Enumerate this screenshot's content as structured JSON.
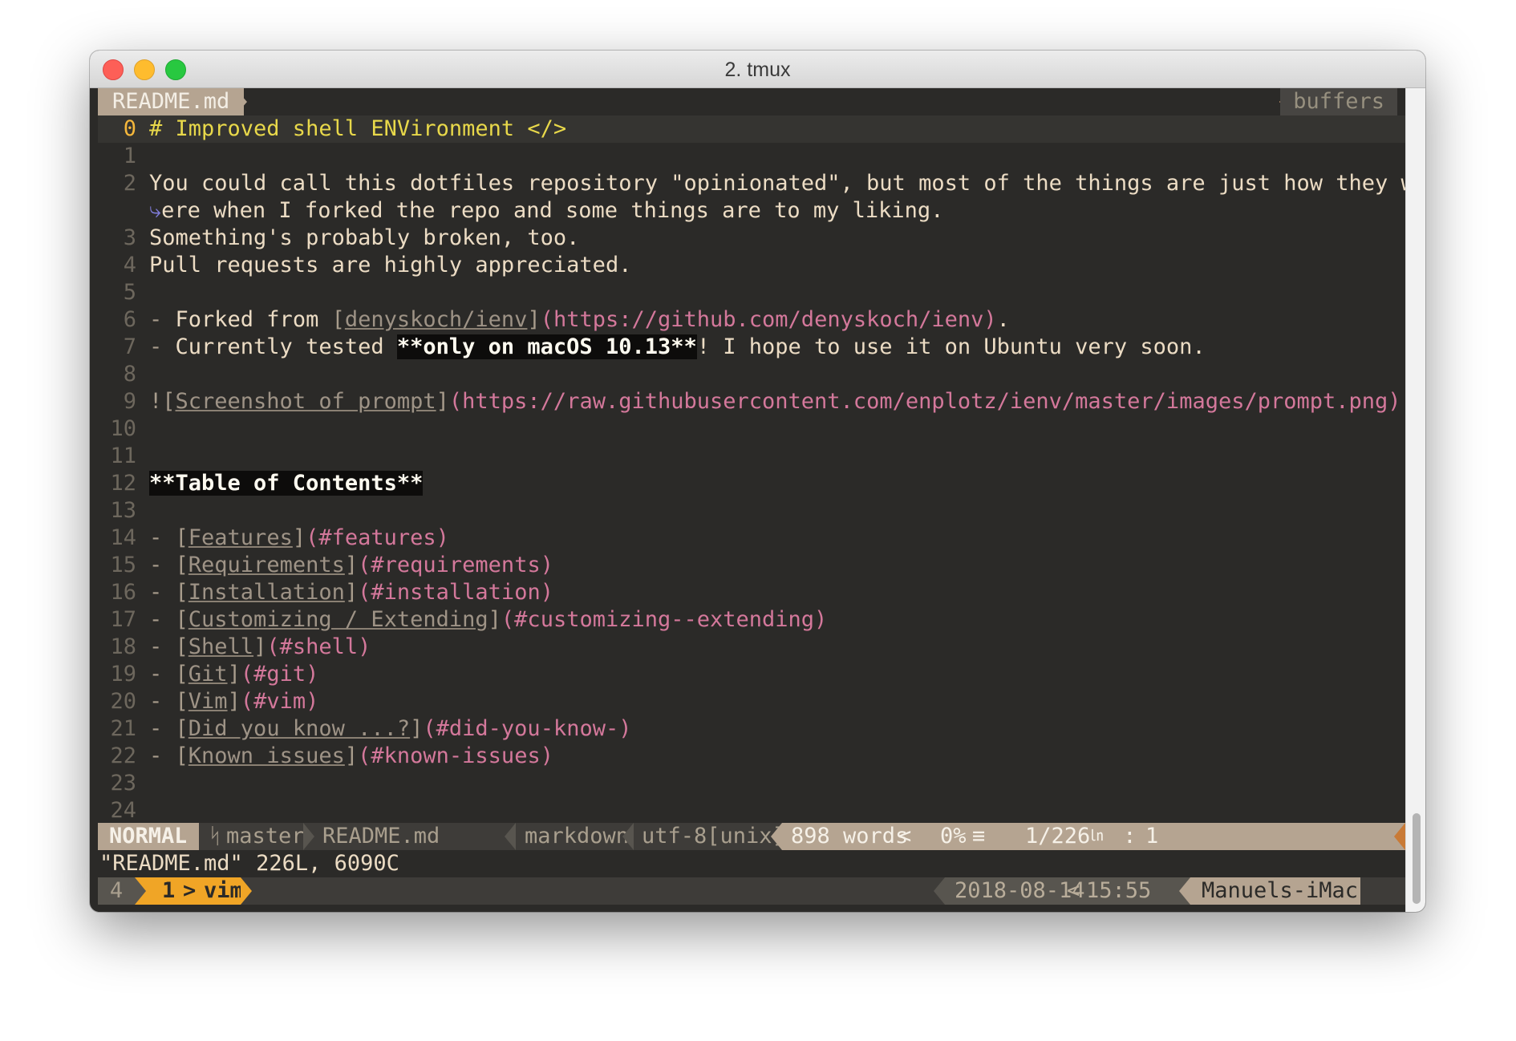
{
  "window": {
    "title": "2. tmux"
  },
  "tabline": {
    "tab_label": "README.md",
    "buffers_label": "buffers"
  },
  "editor": {
    "lines": [
      {
        "n": "0",
        "parts": [
          {
            "t": "# Improved shell ENVironment </>",
            "c": "h1"
          }
        ]
      },
      {
        "n": "1",
        "parts": []
      },
      {
        "n": "2",
        "parts": [
          {
            "t": "You could call this dotfiles repository \"opinionated\", but most of the things are just how they w",
            "c": ""
          }
        ]
      },
      {
        "n": "",
        "parts": [
          {
            "t": "⤷",
            "c": "wrapmark"
          },
          {
            "t": "ere when I forked the repo and some things are to my liking.",
            "c": ""
          }
        ]
      },
      {
        "n": "3",
        "parts": [
          {
            "t": "Something's probably broken, too.",
            "c": ""
          }
        ]
      },
      {
        "n": "4",
        "parts": [
          {
            "t": "Pull requests are highly appreciated.",
            "c": ""
          }
        ]
      },
      {
        "n": "5",
        "parts": []
      },
      {
        "n": "6",
        "parts": [
          {
            "t": "- ",
            "c": "dim"
          },
          {
            "t": "Forked from ",
            "c": ""
          },
          {
            "t": "[",
            "c": "dim"
          },
          {
            "t": "denyskoch/ienv",
            "c": "link"
          },
          {
            "t": "]",
            "c": "dim"
          },
          {
            "t": "(https://github.com/denyskoch/ienv)",
            "c": "url"
          },
          {
            "t": ".",
            "c": ""
          }
        ]
      },
      {
        "n": "7",
        "parts": [
          {
            "t": "- ",
            "c": "dim"
          },
          {
            "t": "Currently tested ",
            "c": ""
          },
          {
            "t": "**only on macOS 10.13**",
            "c": "bold"
          },
          {
            "t": "! I hope to use it on Ubuntu very soon.",
            "c": ""
          }
        ]
      },
      {
        "n": "8",
        "parts": []
      },
      {
        "n": "9",
        "parts": [
          {
            "t": "![",
            "c": "dim"
          },
          {
            "t": "Screenshot of prompt",
            "c": "link"
          },
          {
            "t": "]",
            "c": "dim"
          },
          {
            "t": "(https://raw.githubusercontent.com/enplotz/ienv/master/images/prompt.png)",
            "c": "url"
          }
        ]
      },
      {
        "n": "10",
        "parts": []
      },
      {
        "n": "11",
        "parts": []
      },
      {
        "n": "12",
        "parts": [
          {
            "t": "**Table of Contents**",
            "c": "bold"
          }
        ]
      },
      {
        "n": "13",
        "parts": []
      },
      {
        "n": "14",
        "parts": [
          {
            "t": "- [",
            "c": "dim"
          },
          {
            "t": "Features",
            "c": "link"
          },
          {
            "t": "]",
            "c": "dim"
          },
          {
            "t": "(#features)",
            "c": "url"
          }
        ]
      },
      {
        "n": "15",
        "parts": [
          {
            "t": "- [",
            "c": "dim"
          },
          {
            "t": "Requirements",
            "c": "link"
          },
          {
            "t": "]",
            "c": "dim"
          },
          {
            "t": "(#requirements)",
            "c": "url"
          }
        ]
      },
      {
        "n": "16",
        "parts": [
          {
            "t": "- [",
            "c": "dim"
          },
          {
            "t": "Installation",
            "c": "link"
          },
          {
            "t": "]",
            "c": "dim"
          },
          {
            "t": "(#installation)",
            "c": "url"
          }
        ]
      },
      {
        "n": "17",
        "parts": [
          {
            "t": "- [",
            "c": "dim"
          },
          {
            "t": "Customizing / Extending",
            "c": "link"
          },
          {
            "t": "]",
            "c": "dim"
          },
          {
            "t": "(#customizing--extending)",
            "c": "url"
          }
        ]
      },
      {
        "n": "18",
        "parts": [
          {
            "t": "- [",
            "c": "dim"
          },
          {
            "t": "Shell",
            "c": "link"
          },
          {
            "t": "]",
            "c": "dim"
          },
          {
            "t": "(#shell)",
            "c": "url"
          }
        ]
      },
      {
        "n": "19",
        "parts": [
          {
            "t": "- [",
            "c": "dim"
          },
          {
            "t": "Git",
            "c": "link"
          },
          {
            "t": "]",
            "c": "dim"
          },
          {
            "t": "(#git)",
            "c": "url"
          }
        ]
      },
      {
        "n": "20",
        "parts": [
          {
            "t": "- [",
            "c": "dim"
          },
          {
            "t": "Vim",
            "c": "link"
          },
          {
            "t": "]",
            "c": "dim"
          },
          {
            "t": "(#vim)",
            "c": "url"
          }
        ]
      },
      {
        "n": "21",
        "parts": [
          {
            "t": "- [",
            "c": "dim"
          },
          {
            "t": "Did you know ...?",
            "c": "link"
          },
          {
            "t": "]",
            "c": "dim"
          },
          {
            "t": "(#did-you-know-)",
            "c": "url"
          }
        ]
      },
      {
        "n": "22",
        "parts": [
          {
            "t": "- [",
            "c": "dim"
          },
          {
            "t": "Known issues",
            "c": "link"
          },
          {
            "t": "]",
            "c": "dim"
          },
          {
            "t": "(#known-issues)",
            "c": "url"
          }
        ]
      },
      {
        "n": "23",
        "parts": []
      },
      {
        "n": "24",
        "parts": []
      }
    ]
  },
  "statusline": {
    "mode": "NORMAL",
    "branch_icon": "ᛋ",
    "branch": "master",
    "filename": "README.md",
    "filetype": "markdown",
    "encoding": "utf-8[unix]",
    "words": "898 words",
    "percent": "0%",
    "percent_icon": "≡",
    "position": "1/226",
    "line_icon": "㏑",
    "column": "1"
  },
  "cmdline": {
    "message": "\"README.md\" 226L, 6090C"
  },
  "tmux": {
    "session": "4",
    "window_index": "1",
    "window_name": "vim",
    "date": "2018-08-14",
    "time": "15:55",
    "host": "Manuels-iMac"
  },
  "colors": {
    "background": "#2b2a28",
    "accent_tan": "#b5a491",
    "accent_orange": "#f0a526",
    "heading": "#e8d84a",
    "url": "#d4789b"
  }
}
